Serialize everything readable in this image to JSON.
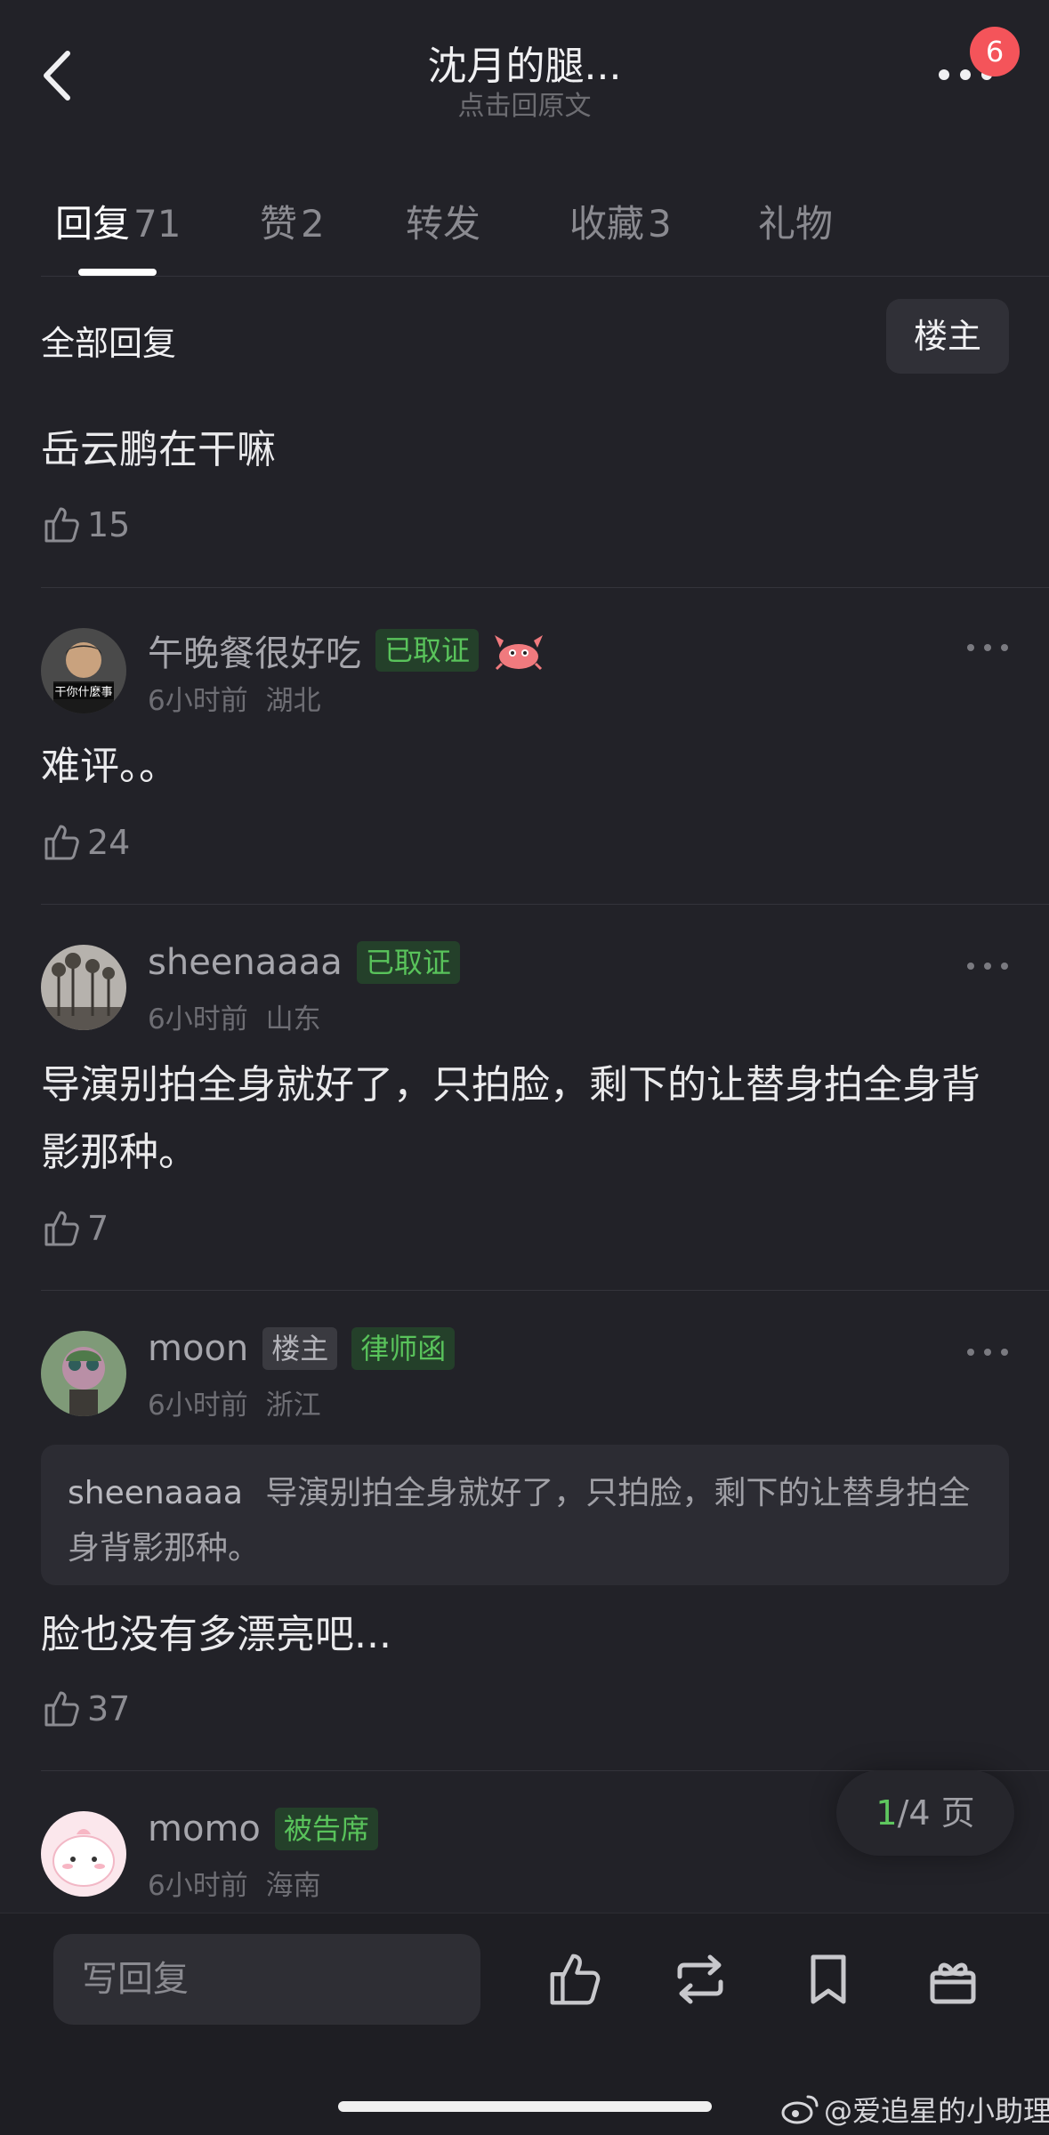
{
  "header": {
    "title": "沈月的腿...",
    "subtitle": "点击回原文",
    "notification_count": "6"
  },
  "tabs": [
    {
      "label": "回复",
      "count": "71"
    },
    {
      "label": "赞",
      "count": "2"
    },
    {
      "label": "转发",
      "count": ""
    },
    {
      "label": "收藏",
      "count": "3"
    },
    {
      "label": "礼物",
      "count": ""
    }
  ],
  "section": {
    "title": "全部回复",
    "filter_label": "楼主"
  },
  "comments": [
    {
      "text": "岳云鹏在干嘛",
      "likes": "15"
    },
    {
      "username": "午晚餐很好吃",
      "tags": [
        "已取证"
      ],
      "time": "6小时前",
      "location": "湖北",
      "text": "难评。。",
      "likes": "24",
      "avatar_text": "干你什麼事"
    },
    {
      "username": "sheenaaaa",
      "tags": [
        "已取证"
      ],
      "time": "6小时前",
      "location": "山东",
      "text": "导演别拍全身就好了，只拍脸，剩下的让替身拍全身背影那种。",
      "likes": "7"
    },
    {
      "username": "moon",
      "tags": [
        "楼主",
        "律师函"
      ],
      "time": "6小时前",
      "location": "浙江",
      "quote_user": "sheenaaaa",
      "quote_text": "导演别拍全身就好了，只拍脸，剩下的让替身拍全身背影那种。",
      "text": "脸也没有多漂亮吧...",
      "likes": "37"
    },
    {
      "username": "momo",
      "tags": [
        "被告席"
      ],
      "time": "6小时前",
      "location": "海南"
    }
  ],
  "pager": {
    "current": "1",
    "total": "/4 页"
  },
  "bottom_bar": {
    "reply_placeholder": "写回复",
    "icons": [
      "like-icon",
      "repost-icon",
      "bookmark-icon",
      "gift-icon"
    ]
  },
  "watermark": "@爱追星的小助理",
  "colors": {
    "background": "#222228",
    "accent_green": "#59c35b",
    "badge_red": "#f4545a"
  }
}
